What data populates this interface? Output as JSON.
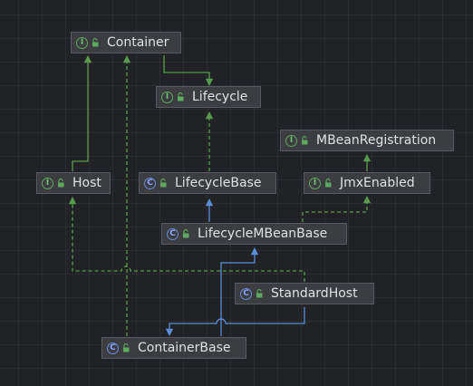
{
  "colors": {
    "background": "#202226",
    "node_fill": "#3b3d41",
    "node_border": "#575a60",
    "interface_badge": "#5fa85f",
    "class_badge": "#6b8cd9",
    "implements_edge": "#5a9a4e",
    "extends_edge": "#5a8ed6"
  },
  "badges": {
    "interface": "I",
    "class": "C"
  },
  "nodes": {
    "container": {
      "label": "Container",
      "kind": "interface",
      "icon": "interface-icon"
    },
    "lifecycle": {
      "label": "Lifecycle",
      "kind": "interface",
      "icon": "interface-icon"
    },
    "mbean_registration": {
      "label": "MBeanRegistration",
      "kind": "interface",
      "icon": "interface-icon"
    },
    "host": {
      "label": "Host",
      "kind": "interface",
      "icon": "interface-icon"
    },
    "lifecycle_base": {
      "label": "LifecycleBase",
      "kind": "class",
      "icon": "class-icon"
    },
    "jmx_enabled": {
      "label": "JmxEnabled",
      "kind": "interface",
      "icon": "interface-icon"
    },
    "lifecycle_mbean_base": {
      "label": "LifecycleMBeanBase",
      "kind": "class",
      "icon": "class-icon"
    },
    "standard_host": {
      "label": "StandardHost",
      "kind": "class",
      "icon": "class-icon"
    },
    "container_base": {
      "label": "ContainerBase",
      "kind": "class",
      "icon": "class-icon"
    }
  },
  "edges": [
    {
      "from": "Container",
      "to": "Lifecycle",
      "type": "extends-interface"
    },
    {
      "from": "Host",
      "to": "Container",
      "type": "extends-interface"
    },
    {
      "from": "JmxEnabled",
      "to": "MBeanRegistration",
      "type": "extends-interface"
    },
    {
      "from": "LifecycleBase",
      "to": "Lifecycle",
      "type": "implements"
    },
    {
      "from": "LifecycleMBeanBase",
      "to": "LifecycleBase",
      "type": "extends"
    },
    {
      "from": "LifecycleMBeanBase",
      "to": "JmxEnabled",
      "type": "implements"
    },
    {
      "from": "StandardHost",
      "to": "Host",
      "type": "implements"
    },
    {
      "from": "StandardHost",
      "to": "ContainerBase",
      "type": "extends"
    },
    {
      "from": "ContainerBase",
      "to": "Container",
      "type": "implements"
    },
    {
      "from": "ContainerBase",
      "to": "LifecycleMBeanBase",
      "type": "extends"
    }
  ]
}
